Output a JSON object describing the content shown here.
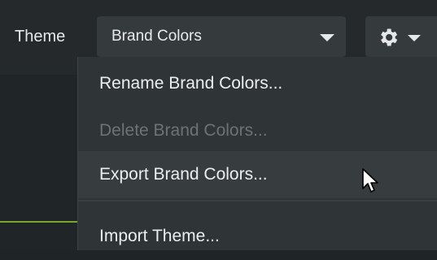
{
  "toolbar": {
    "theme_label": "Theme",
    "theme_select": {
      "value": "Brand Colors",
      "icon": "chevron-down-icon"
    },
    "settings_button": {
      "icon": "gear-icon",
      "caret": "chevron-down-icon"
    }
  },
  "menu": {
    "items": [
      {
        "label": "Rename Brand Colors...",
        "state": "normal"
      },
      {
        "label": "Delete Brand Colors...",
        "state": "disabled"
      },
      {
        "label": "Export Brand Colors...",
        "state": "hover"
      },
      {
        "label": "Import Theme...",
        "state": "normal"
      }
    ]
  },
  "colors": {
    "toolbar_bg": "#25292b",
    "control_bg": "#353a3d",
    "menu_bg": "#2f3436",
    "menu_hover_bg": "#373c3f",
    "text": "#eceeee",
    "disabled_text": "#6c7375",
    "accent": "#7aa629"
  },
  "cursor": {
    "icon": "arrow-cursor-icon"
  }
}
